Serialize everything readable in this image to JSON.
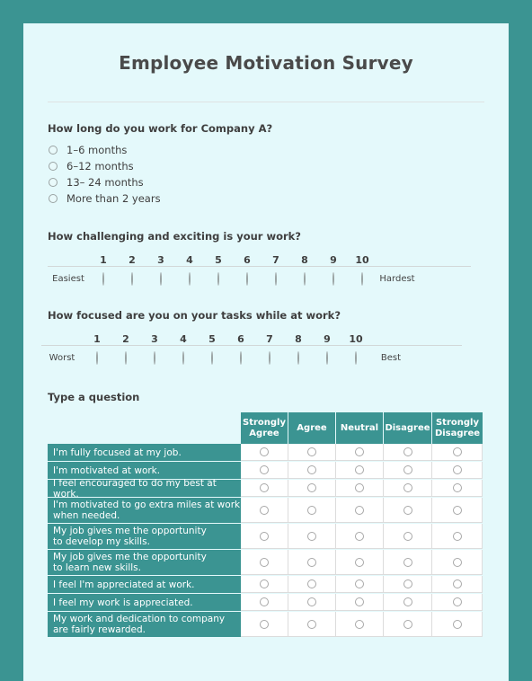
{
  "colors": {
    "frame": "#3b9492",
    "page_bg": "#e4f9fb",
    "teal": "#3b9492",
    "text": "#3f3f3f"
  },
  "header": {
    "title": "Employee Motivation Survey"
  },
  "questions": {
    "tenure": {
      "label": "How long do you work for Company A?",
      "options": [
        "1–6 months",
        "6–12 months",
        "13– 24 months",
        "More than 2 years"
      ]
    },
    "challenge": {
      "label": "How challenging and exciting is your work?",
      "scale": [
        "1",
        "2",
        "3",
        "4",
        "5",
        "6",
        "7",
        "8",
        "9",
        "10"
      ],
      "left_anchor": "Easiest",
      "right_anchor": "Hardest"
    },
    "focus": {
      "label": "How focused are you on your tasks while at work?",
      "scale": [
        "1",
        "2",
        "3",
        "4",
        "5",
        "6",
        "7",
        "8",
        "9",
        "10"
      ],
      "left_anchor": "Worst",
      "right_anchor": "Best"
    },
    "matrix": {
      "label": "Type a question",
      "columns": [
        "Strongly Agree",
        "Agree",
        "Neutral",
        "Disagree",
        "Strongly Disagree"
      ],
      "rows": [
        "I'm fully focused at my job.",
        "I'm motivated at work.",
        "I feel encouraged to do my best at work.",
        "I'm motivated to go extra miles at work when needed.",
        "My job gives me the opportunity\n to develop my skills.",
        "My job gives me the opportunity\n to learn new skills.",
        "I feel I'm appreciated at work.",
        "I feel my work is appreciated.",
        "My work and dedication to company are fairly rewarded."
      ]
    }
  }
}
